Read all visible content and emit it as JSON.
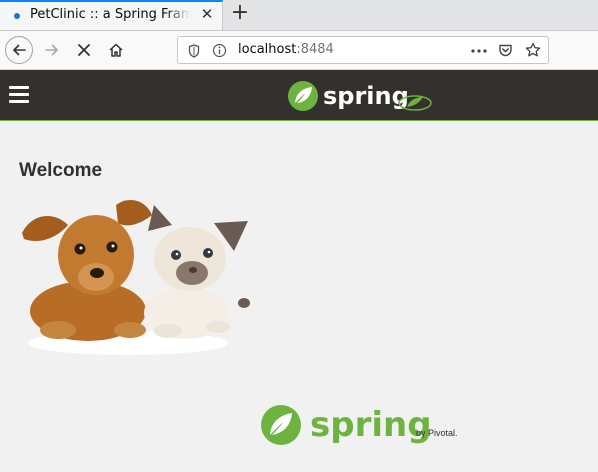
{
  "browser": {
    "tab_title": "PetClinic :: a Spring Framework demonstration",
    "tab_close": "✕",
    "new_tab": "+",
    "url_host": "localhost",
    "url_port": ":8484"
  },
  "header": {
    "brand": "spring"
  },
  "main": {
    "heading": "Welcome"
  },
  "footer": {
    "brand": "spring",
    "byline": "by Pivotal."
  },
  "colors": {
    "spring_green": "#6db33f",
    "header_bg": "#34302d",
    "page_bg": "#f1f1f1"
  }
}
